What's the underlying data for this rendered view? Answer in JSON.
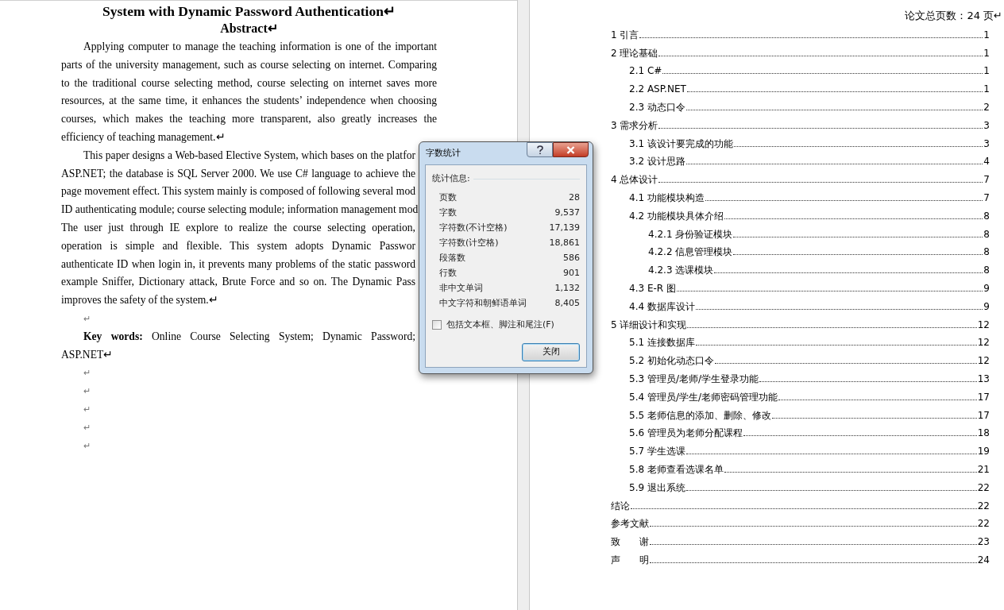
{
  "left_page": {
    "title": "System with Dynamic Password Authentication↵",
    "heading": "Abstract↵",
    "lines": [
      {
        "kind": "full",
        "indent": true,
        "text": "Applying computer to manage the teaching information is one of the important"
      },
      {
        "kind": "full",
        "indent": false,
        "text": "parts of the university management, such as course selecting on internet. Comparing"
      },
      {
        "kind": "full",
        "indent": false,
        "text": "to the traditional course selecting method, course selecting on internet saves more"
      },
      {
        "kind": "full",
        "indent": false,
        "text": "resources, at the same time, it enhances the students’ independence when choosing"
      },
      {
        "kind": "full",
        "indent": false,
        "text": "courses, which makes the teaching more transparent, also greatly increases the"
      },
      {
        "kind": "last",
        "indent": false,
        "text": "efficiency of teaching management.↵"
      },
      {
        "kind": "cut",
        "indent": true,
        "text": "This paper designs a Web-based Elective System, which bases on the platfor"
      },
      {
        "kind": "cut",
        "indent": false,
        "text": "ASP.NET; the database is SQL Server 2000. We use C# language to achieve the"
      },
      {
        "kind": "cut",
        "indent": false,
        "text": "page movement effect. This system mainly is composed of following several mod"
      },
      {
        "kind": "cut",
        "indent": false,
        "text": "ID authenticating module; course selecting module; information management mod"
      },
      {
        "kind": "cut",
        "indent": false,
        "text": "The user just through IE explore to realize the course selecting operation,"
      },
      {
        "kind": "cut",
        "indent": false,
        "text": "operation is simple and flexible. This system adopts Dynamic Passwor"
      },
      {
        "kind": "cut",
        "indent": false,
        "text": "authenticate ID when login in, it prevents many problems of the static password"
      },
      {
        "kind": "cut",
        "indent": false,
        "text": "example Sniffer, Dictionary attack, Brute Force and so on. The Dynamic Pass"
      },
      {
        "kind": "last",
        "indent": false,
        "text": "improves the safety of the system.↵"
      },
      {
        "kind": "empty",
        "indent": true,
        "text": "↵"
      },
      {
        "kind": "cut",
        "indent": true,
        "text": "**Key words:** Online Course Selecting System; Dynamic Password;"
      },
      {
        "kind": "last",
        "indent": false,
        "text": "ASP.NET↵"
      },
      {
        "kind": "empty",
        "indent": true,
        "text": "↵"
      },
      {
        "kind": "empty",
        "indent": true,
        "text": "↵"
      },
      {
        "kind": "empty",
        "indent": true,
        "text": "↵"
      },
      {
        "kind": "empty",
        "indent": true,
        "text": "↵"
      },
      {
        "kind": "empty",
        "indent": true,
        "text": "↵"
      }
    ]
  },
  "right_page": {
    "page_count": "论文总页数：24 页↵",
    "toc": [
      {
        "title": "1 引言",
        "page": "1"
      },
      {
        "title": "2 理论基础",
        "page": "1",
        "children": [
          {
            "title": "2.1 C#",
            "page": "1"
          },
          {
            "title": "2.2 ASP.NET",
            "page": "1"
          },
          {
            "title": "2.3 动态口令",
            "page": "2"
          }
        ]
      },
      {
        "title": "3 需求分析",
        "page": "3",
        "children": [
          {
            "title": "3.1 该设计要完成的功能",
            "page": "3"
          },
          {
            "title": "3.2 设计思路",
            "page": "4"
          }
        ]
      },
      {
        "title": "4 总体设计",
        "page": "7",
        "children": [
          {
            "title": "4.1 功能模块构造",
            "page": "7"
          },
          {
            "title": "4.2 功能模块具体介绍",
            "page": "8",
            "children": [
              {
                "title": "4.2.1 身份验证模块",
                "page": "8"
              },
              {
                "title": "4.2.2 信息管理模块",
                "page": "8"
              },
              {
                "title": "4.2.3 选课模块",
                "page": "8"
              }
            ]
          },
          {
            "title": "4.3 E-R 图",
            "page": "9"
          },
          {
            "title": "4.4 数据库设计",
            "page": "9"
          }
        ]
      },
      {
        "title": "5 详细设计和实现",
        "page": "12",
        "children": [
          {
            "title": "5.1 连接数据库",
            "page": "12"
          },
          {
            "title": "5.2 初始化动态口令",
            "page": "12"
          },
          {
            "title": "5.3 管理员/老师/学生登录功能",
            "page": "13"
          },
          {
            "title": "5.4 管理员/学生/老师密码管理功能",
            "page": "17"
          },
          {
            "title": "5.5 老师信息的添加、删除、修改",
            "page": "17"
          },
          {
            "title": "5.6 管理员为老师分配课程",
            "page": "18"
          },
          {
            "title": "5.7 学生选课",
            "page": "19"
          },
          {
            "title": "5.8 老师查看选课名单",
            "page": "21"
          },
          {
            "title": "5.9 退出系统",
            "page": "22"
          }
        ]
      },
      {
        "title": "结论",
        "page": "22"
      },
      {
        "title": "参考文献",
        "page": "22"
      },
      {
        "title": "致　　谢",
        "page": "23"
      },
      {
        "title": "声　　明",
        "page": "24"
      }
    ]
  },
  "dialog": {
    "title": "字数统计",
    "group_label": "统计信息:",
    "stats": [
      {
        "label": "页数",
        "value": "28"
      },
      {
        "label": "字数",
        "value": "9,537"
      },
      {
        "label": "字符数(不计空格)",
        "value": "17,139"
      },
      {
        "label": "字符数(计空格)",
        "value": "18,861"
      },
      {
        "label": "段落数",
        "value": "586"
      },
      {
        "label": "行数",
        "value": "901"
      },
      {
        "label": "非中文单词",
        "value": "1,132"
      },
      {
        "label": "中文字符和朝鲜语单词",
        "value": "8,405"
      }
    ],
    "checkbox": {
      "label": "包括文本框、脚注和尾注(F)",
      "checked": false
    },
    "close_button": "关闭"
  }
}
